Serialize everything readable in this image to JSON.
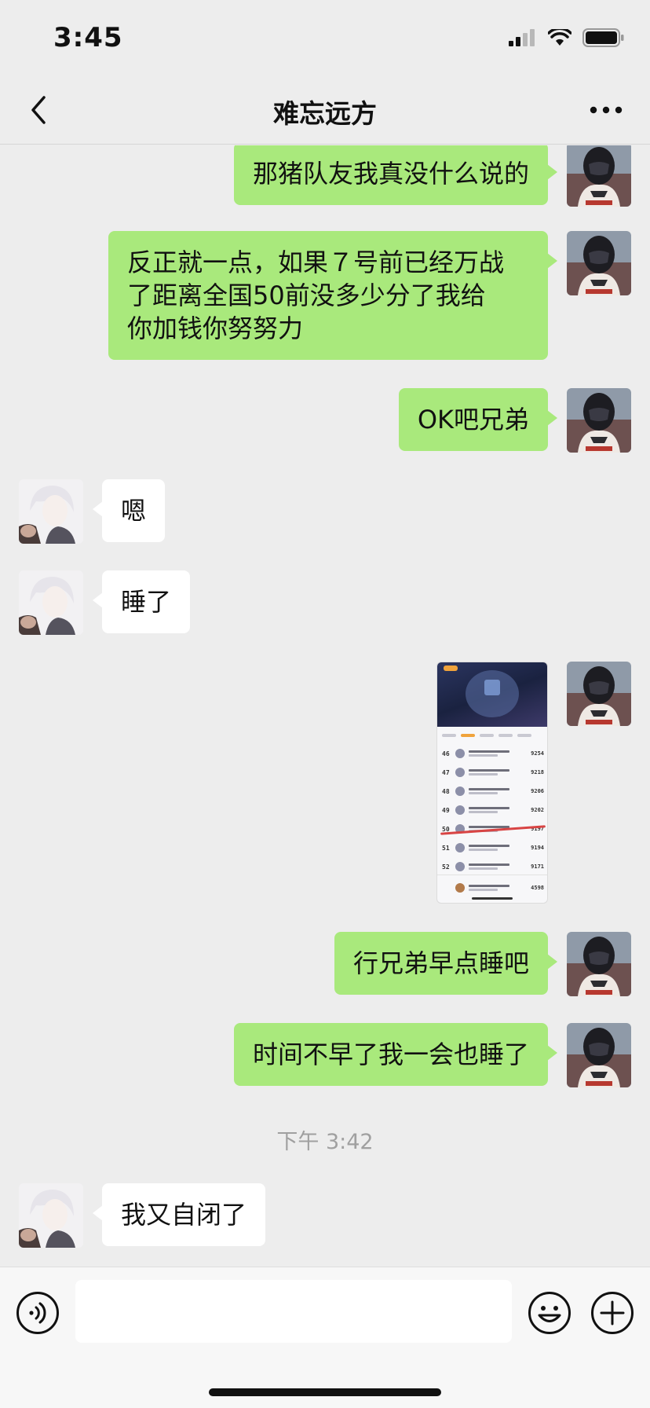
{
  "status_bar": {
    "time": "3:45"
  },
  "header": {
    "title": "难忘远方"
  },
  "messages": [
    {
      "sender": "me",
      "type": "text",
      "text": "那猪队友我真没什么说的"
    },
    {
      "sender": "me",
      "type": "text",
      "lines": [
        "反正就一点，如果７号前已经万战",
        "了距离全国50前没多少分了我给",
        "你加钱你努努力"
      ]
    },
    {
      "sender": "me",
      "type": "text",
      "text": "OK吧兄弟"
    },
    {
      "sender": "other",
      "type": "text",
      "text": "嗯"
    },
    {
      "sender": "other",
      "type": "text",
      "text": "睡了"
    },
    {
      "sender": "me",
      "type": "image",
      "image": {
        "ranks": [
          "46",
          "47",
          "48",
          "49",
          "50",
          "51",
          "52"
        ],
        "scores": [
          "9254",
          "9218",
          "9206",
          "9202",
          "9197",
          "9194",
          "9171"
        ],
        "footer_score": "4598"
      }
    },
    {
      "sender": "me",
      "type": "text",
      "text": "行兄弟早点睡吧"
    },
    {
      "sender": "me",
      "type": "text",
      "text": "时间不早了我一会也睡了"
    },
    {
      "type": "timestamp",
      "text": "下午 3:42"
    },
    {
      "sender": "other",
      "type": "text",
      "text": "我又自闭了"
    }
  ],
  "input": {
    "value": "",
    "placeholder": ""
  },
  "colors": {
    "background": "#ededed",
    "my_bubble": "#a9e97c",
    "other_bubble": "#ffffff",
    "timestamp": "#a0a0a0"
  },
  "icons": {
    "back": "chevron-left-icon",
    "more": "more-icon",
    "voice": "voice-icon",
    "emoji": "emoji-icon",
    "plus": "plus-icon"
  }
}
